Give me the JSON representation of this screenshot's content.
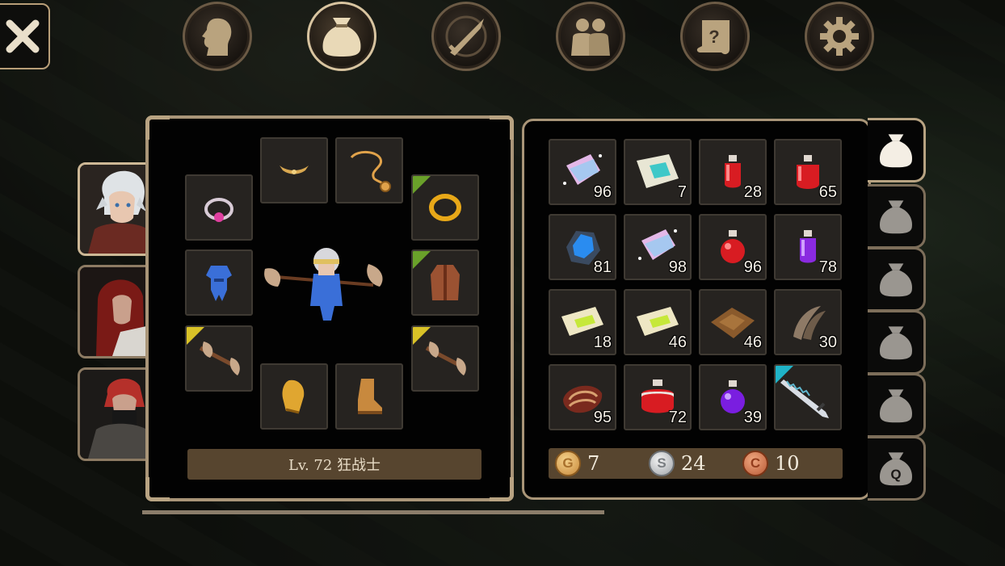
{
  "top_menu": {
    "items": [
      {
        "name": "character",
        "icon": "head-icon"
      },
      {
        "name": "inventory",
        "icon": "bag-icon",
        "active": true
      },
      {
        "name": "skills",
        "icon": "crossed-sword-icon"
      },
      {
        "name": "party",
        "icon": "party-icon"
      },
      {
        "name": "quests",
        "icon": "scroll-icon"
      },
      {
        "name": "settings",
        "icon": "gear-icon"
      }
    ]
  },
  "party": [
    {
      "name": "white-haired-warrior",
      "active": true
    },
    {
      "name": "red-haired-mage",
      "active": false
    },
    {
      "name": "masked-rogue",
      "active": false
    }
  ],
  "equipment": {
    "level_text": "Lv. 72 狂战士",
    "slots": [
      {
        "slot": "head",
        "icon": "circlet-icon"
      },
      {
        "slot": "neck",
        "icon": "necklace-icon"
      },
      {
        "slot": "ring-left",
        "icon": "ring-icon"
      },
      {
        "slot": "ring-right",
        "icon": "gold-ring-icon",
        "corner": "#6aa12a"
      },
      {
        "slot": "armor",
        "icon": "armor-icon"
      },
      {
        "slot": "cloak",
        "icon": "vest-icon",
        "corner": "#6aa12a"
      },
      {
        "slot": "weapon-left",
        "icon": "axe-icon",
        "corner": "#d9c227"
      },
      {
        "slot": "weapon-right",
        "icon": "axe-icon",
        "corner": "#d9c227"
      },
      {
        "slot": "gloves",
        "icon": "glove-icon"
      },
      {
        "slot": "boots",
        "icon": "boot-icon"
      }
    ]
  },
  "inventory": {
    "items": [
      {
        "icon": "pink-fabric-icon",
        "qty": "96"
      },
      {
        "icon": "teal-scroll-icon",
        "qty": "7"
      },
      {
        "icon": "small-red-potion-icon",
        "qty": "28"
      },
      {
        "icon": "red-potion-icon",
        "qty": "65"
      },
      {
        "icon": "blue-crystal-ore-icon",
        "qty": "81"
      },
      {
        "icon": "pink-fabric-icon",
        "qty": "98"
      },
      {
        "icon": "round-red-potion-icon",
        "qty": "96"
      },
      {
        "icon": "purple-potion-icon",
        "qty": "78"
      },
      {
        "icon": "green-scroll-icon",
        "qty": "18"
      },
      {
        "icon": "green-scroll-icon",
        "qty": "46"
      },
      {
        "icon": "leather-icon",
        "qty": "46"
      },
      {
        "icon": "claw-icon",
        "qty": "30"
      },
      {
        "icon": "red-scale-icon",
        "qty": "95"
      },
      {
        "icon": "large-red-potion-icon",
        "qty": "72"
      },
      {
        "icon": "round-purple-potion-icon",
        "qty": "39"
      },
      {
        "icon": "serrated-sword-icon",
        "qty": "",
        "corner": "#1fb3c7"
      }
    ],
    "currency": {
      "gold": {
        "symbol": "G",
        "amount": "7"
      },
      "silver": {
        "symbol": "S",
        "amount": "24"
      },
      "copper": {
        "symbol": "C",
        "amount": "10"
      }
    },
    "bag_tabs": [
      {
        "name": "bag-1",
        "active": true
      },
      {
        "name": "bag-2"
      },
      {
        "name": "bag-3"
      },
      {
        "name": "bag-4"
      },
      {
        "name": "bag-5"
      },
      {
        "name": "quest-bag",
        "label": "Q"
      }
    ]
  },
  "colors": {
    "panel_border": "#a99578",
    "slot_bg": "#262320",
    "bar_bg": "#57452f",
    "corner_green": "#6aa12a",
    "corner_yellow": "#d9c227",
    "corner_cyan": "#1fb3c7"
  }
}
